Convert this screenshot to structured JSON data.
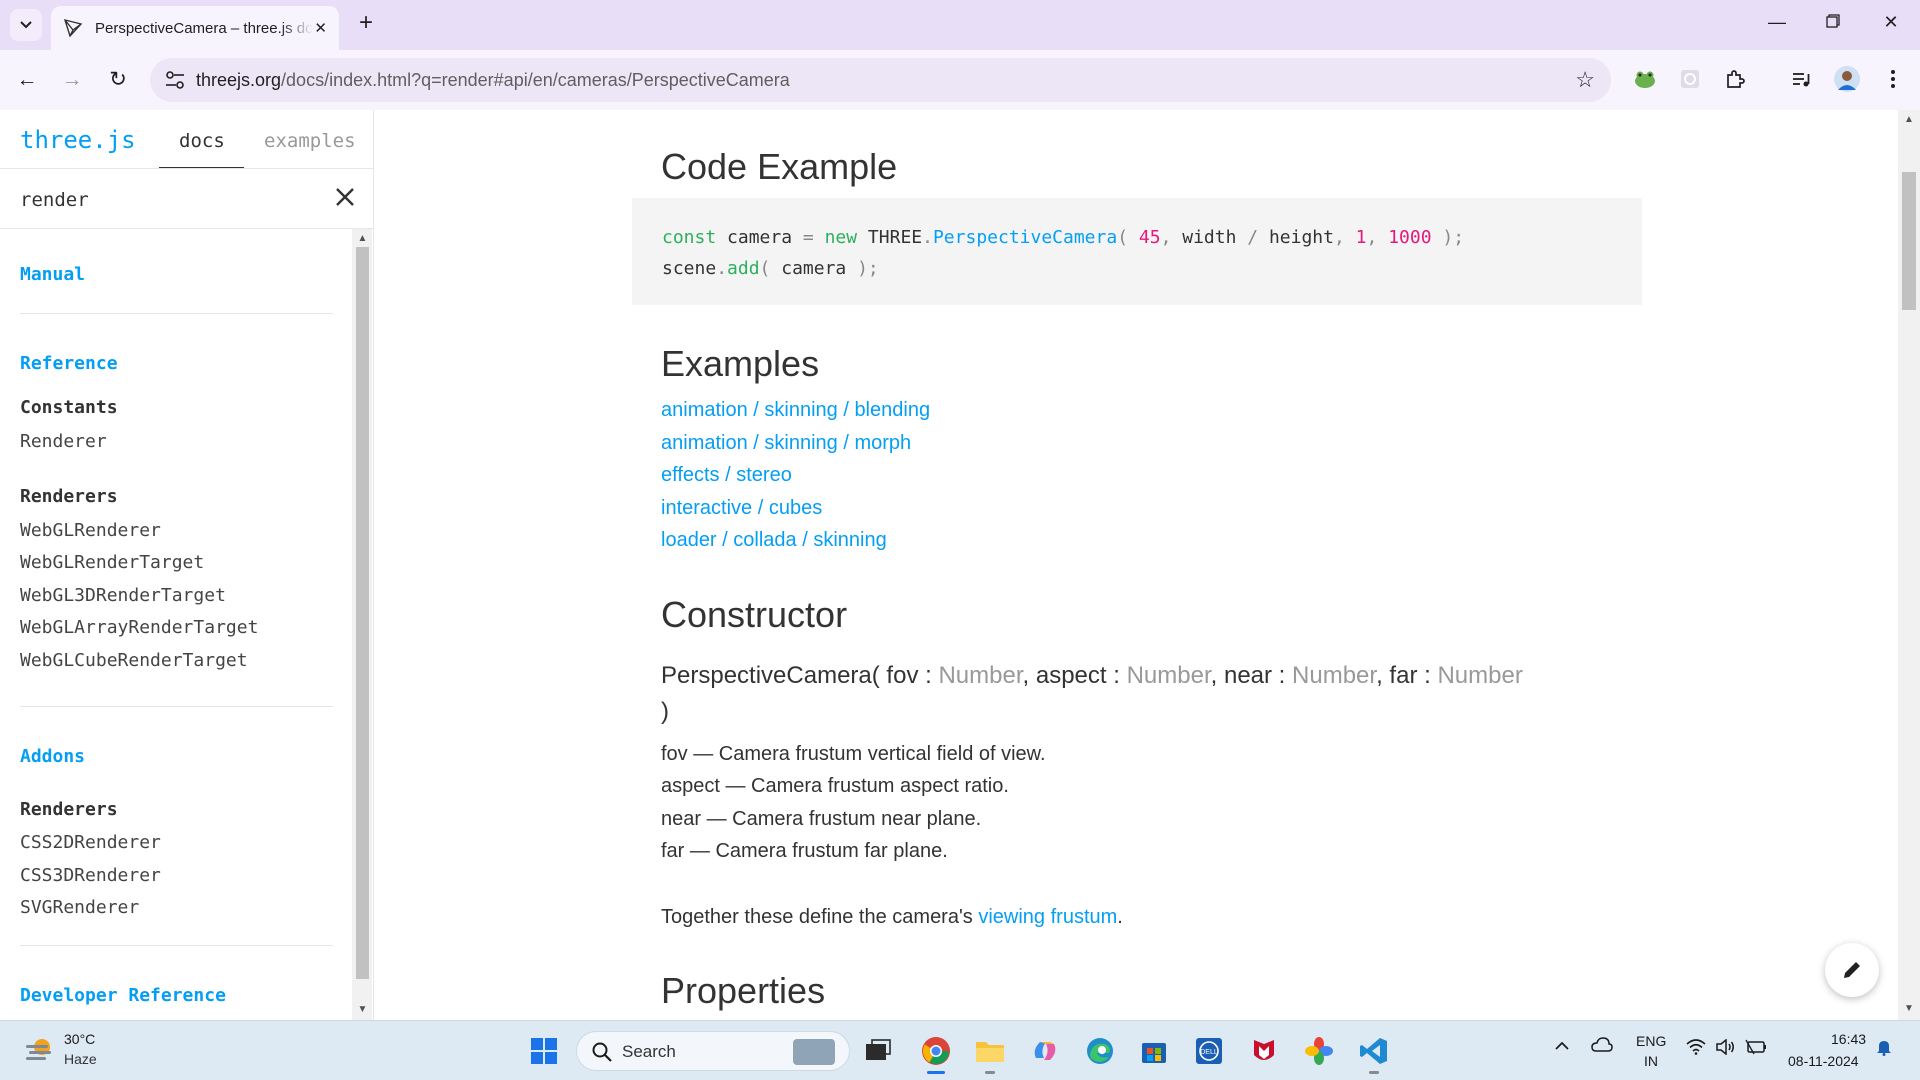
{
  "browser": {
    "tab_title": "PerspectiveCamera – three.js docs",
    "url_host": "threejs.org",
    "url_path": "/docs/index.html?q=render#api/en/cameras/PerspectiveCamera"
  },
  "sidebar": {
    "brand": "three.js",
    "tab_docs": "docs",
    "tab_examples": "examples",
    "search_value": "render",
    "manual": "Manual",
    "reference": "Reference",
    "group_constants": "Constants",
    "constants_items": [
      "Renderer"
    ],
    "group_renderers": "Renderers",
    "renderers_items": [
      "WebGLRenderer",
      "WebGLRenderTarget",
      "WebGL3DRenderTarget",
      "WebGLArrayRenderTarget",
      "WebGLCubeRenderTarget"
    ],
    "addons": "Addons",
    "group_addon_renderers": "Renderers",
    "addon_renderers_items": [
      "CSS2DRenderer",
      "CSS3DRenderer",
      "SVGRenderer"
    ],
    "developer_reference": "Developer Reference"
  },
  "content": {
    "code_example_heading": "Code Example",
    "code": {
      "l1_kw1": "const",
      "l1_t1": " camera ",
      "l1_p1": "=",
      "l1_t2": " ",
      "l1_kw2": "new",
      "l1_t3": " THREE",
      "l1_p2": ".",
      "l1_fn": "PerspectiveCamera",
      "l1_p3": "(",
      "l1_t4": " ",
      "l1_n1": "45",
      "l1_p4": ",",
      "l1_t5": " width ",
      "l1_p5": "/",
      "l1_t6": " height",
      "l1_p6": ",",
      "l1_t7": " ",
      "l1_n2": "1",
      "l1_p7": ",",
      "l1_t8": " ",
      "l1_n3": "1000",
      "l1_t9": " ",
      "l1_p8": ");",
      "l2_t1": "scene",
      "l2_p1": ".",
      "l2_kw": "add",
      "l2_p2": "(",
      "l2_t2": " camera ",
      "l2_p3": ");"
    },
    "examples_heading": "Examples",
    "examples_links": [
      "animation / skinning / blending",
      "animation / skinning / morph",
      "effects / stereo",
      "interactive / cubes",
      "loader / collada / skinning"
    ],
    "constructor_heading": "Constructor",
    "ctor": {
      "name": "PerspectiveCamera( ",
      "p1": "fov",
      "t1": "Number",
      "p2": "aspect",
      "t2": "Number",
      "p3": "near",
      "t3": "Number",
      "p4": "far",
      "t4": "Number",
      "colon": " : ",
      "comma": ", ",
      "close": ")"
    },
    "params": [
      "fov — Camera frustum vertical field of view.",
      "aspect — Camera frustum aspect ratio.",
      "near — Camera frustum near plane.",
      "far — Camera frustum far plane."
    ],
    "together_text": "Together these define the camera's ",
    "together_link": "viewing frustum",
    "together_end": ".",
    "properties_heading": "Properties"
  },
  "taskbar": {
    "temp": "30°C",
    "weather": "Haze",
    "search_placeholder": "Search",
    "lang1": "ENG",
    "lang2": "IN",
    "time": "16:43",
    "date": "08-11-2024"
  },
  "colors": {
    "accent": "#049ef4",
    "keyword": "#2cb05d",
    "number": "#e6197c",
    "type_gray": "#999999",
    "tabbar_bg": "#e8def8",
    "taskbar_bg": "#dde9f3"
  },
  "icons": [
    "tab-search-icon",
    "threejs-favicon",
    "close-icon",
    "plus-icon",
    "minimize-icon",
    "restore-icon",
    "back-icon",
    "forward-icon",
    "reload-icon",
    "site-info-icon",
    "star-icon",
    "frog-extension-icon",
    "extension-icon",
    "puzzle-icon",
    "media-icon",
    "profile-avatar",
    "pencil-icon",
    "windows-start-icon",
    "search-icon",
    "task-view-icon",
    "chrome-icon",
    "file-explorer-icon",
    "copilot-icon",
    "edge-icon",
    "store-icon",
    "dell-icon",
    "mcafee-icon",
    "photos-icon",
    "vscode-icon",
    "chevron-up-icon",
    "cloud-icon",
    "wifi-icon",
    "volume-icon",
    "battery-icon",
    "bell-icon"
  ]
}
